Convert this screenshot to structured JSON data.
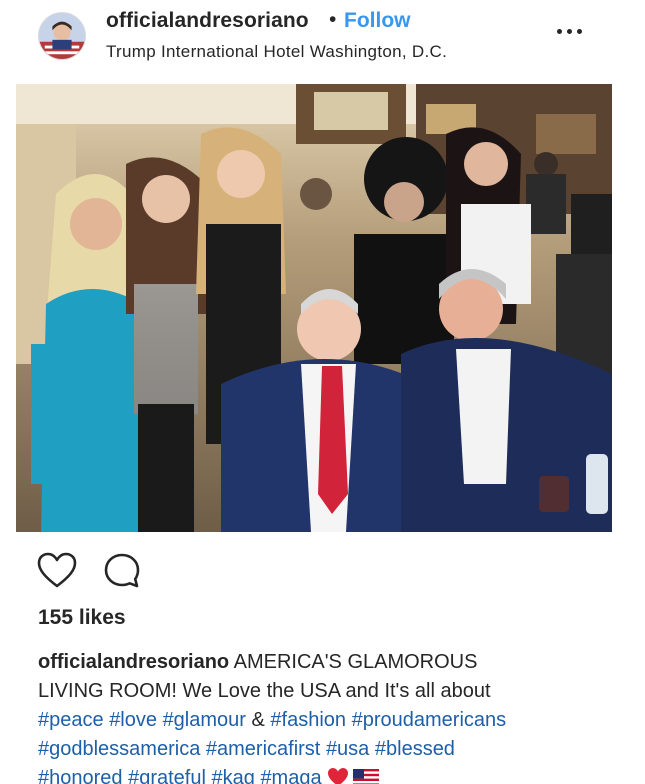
{
  "post": {
    "username": "officialandresoriano",
    "separator": "•",
    "follow_label": "Follow",
    "location": "Trump International Hotel Washington, D.C.",
    "more_icon": "more-options-icon"
  },
  "photo": {
    "icon": "post-photo"
  },
  "actions": {
    "like_icon": "heart-icon",
    "comment_icon": "comment-icon"
  },
  "likes": "155 likes",
  "caption": {
    "username": "officialandresoriano",
    "text_line1": "AMERICA'S GLAMOROUS",
    "text_line2": "LIVING ROOM! We Love the USA and It's all about",
    "hashtags_line3": [
      "#peace",
      "#love",
      "#glamour"
    ],
    "amp": "&",
    "hashtags_line3b": [
      "#fashion",
      "#proudamericans"
    ],
    "hashtags_line4": [
      "#godblessamerica",
      "#americafirst",
      "#usa",
      "#blessed"
    ],
    "hashtags_line5": [
      "#honored",
      "#grateful",
      "#kag",
      "#maga"
    ],
    "emojis": [
      "red-heart-emoji",
      "us-flag-emoji"
    ]
  },
  "colors": {
    "follow": "#3897f0",
    "hashtag": "#1d5fa8",
    "text": "#262626"
  }
}
